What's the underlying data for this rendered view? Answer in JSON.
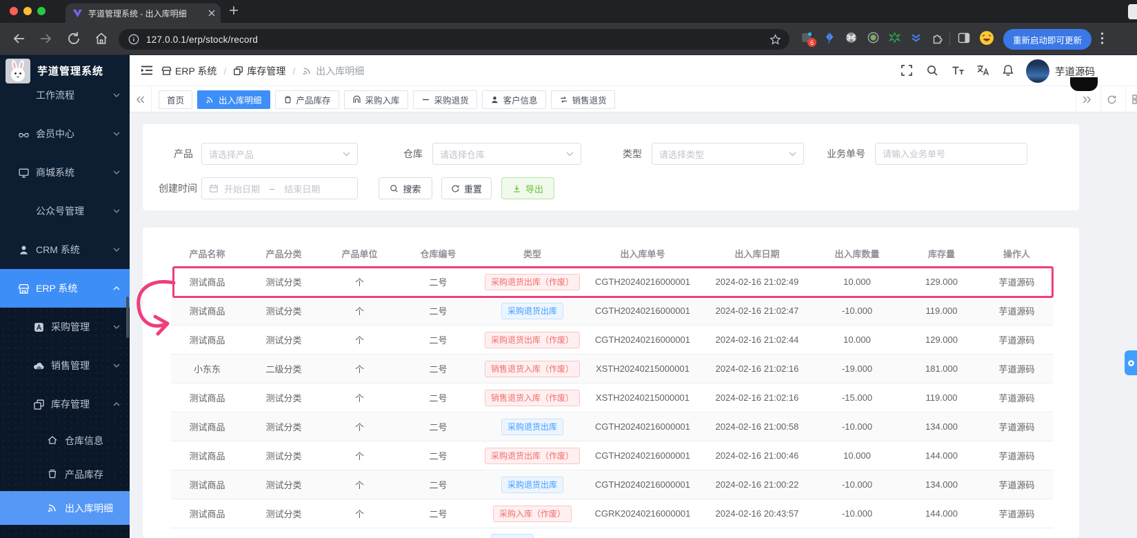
{
  "browser": {
    "tab_title": "芋道管理系统 - 出入库明细",
    "url": "127.0.0.1/erp/stock/record",
    "update_button": "重新启动即可更新",
    "ext_badge": "6"
  },
  "sidebar": {
    "app_title": "芋道管理系统",
    "items": [
      {
        "label": "工作流程"
      },
      {
        "label": "会员中心"
      },
      {
        "label": "商城系统"
      },
      {
        "label": "公众号管理"
      },
      {
        "label": "CRM 系统"
      },
      {
        "label": "ERP 系统"
      },
      {
        "label": "采购管理"
      },
      {
        "label": "销售管理"
      },
      {
        "label": "库存管理"
      },
      {
        "label": "仓库信息"
      },
      {
        "label": "产品库存"
      },
      {
        "label": "出入库明细"
      }
    ]
  },
  "header": {
    "separator": "/",
    "breadcrumb": [
      {
        "label": "ERP 系统"
      },
      {
        "label": "库存管理"
      },
      {
        "label": "出入库明细"
      }
    ],
    "user_name": "芋道源码"
  },
  "tabs": [
    {
      "label": "首页"
    },
    {
      "label": "出入库明细"
    },
    {
      "label": "产品库存"
    },
    {
      "label": "采购入库"
    },
    {
      "label": "采购退货"
    },
    {
      "label": "客户信息"
    },
    {
      "label": "销售退货"
    }
  ],
  "filters": {
    "product_label": "产品",
    "product_placeholder": "请选择产品",
    "warehouse_label": "仓库",
    "warehouse_placeholder": "请选择仓库",
    "type_label": "类型",
    "type_placeholder": "请选择类型",
    "bizno_label": "业务单号",
    "bizno_placeholder": "请输入业务单号",
    "created_label": "创建时间",
    "date_start_placeholder": "开始日期",
    "date_separator": "–",
    "date_end_placeholder": "结束日期",
    "search_label": "搜索",
    "reset_label": "重置",
    "export_label": "导出"
  },
  "table": {
    "columns": [
      "产品名称",
      "产品分类",
      "产品单位",
      "仓库编号",
      "类型",
      "出入库单号",
      "出入库日期",
      "出入库数量",
      "库存量",
      "操作人"
    ],
    "rows": [
      {
        "name": "测试商品",
        "category": "测试分类",
        "unit": "个",
        "warehouse": "二号",
        "type": "采购退货出库（作废）",
        "type_style": "danger",
        "order_no": "CGTH20240216000001",
        "date": "2024-02-16 21:02:49",
        "qty": "10.000",
        "stock": "129.000",
        "operator": "芋道源码"
      },
      {
        "name": "测试商品",
        "category": "测试分类",
        "unit": "个",
        "warehouse": "二号",
        "type": "采购退货出库",
        "type_style": "info",
        "order_no": "CGTH20240216000001",
        "date": "2024-02-16 21:02:47",
        "qty": "-10.000",
        "stock": "119.000",
        "operator": "芋道源码"
      },
      {
        "name": "测试商品",
        "category": "测试分类",
        "unit": "个",
        "warehouse": "二号",
        "type": "采购退货出库（作废）",
        "type_style": "danger",
        "order_no": "CGTH20240216000001",
        "date": "2024-02-16 21:02:44",
        "qty": "10.000",
        "stock": "129.000",
        "operator": "芋道源码"
      },
      {
        "name": "小东东",
        "category": "二级分类",
        "unit": "个",
        "warehouse": "二号",
        "type": "销售退货入库（作废）",
        "type_style": "danger",
        "order_no": "XSTH20240215000001",
        "date": "2024-02-16 21:02:16",
        "qty": "-19.000",
        "stock": "181.000",
        "operator": "芋道源码"
      },
      {
        "name": "测试商品",
        "category": "测试分类",
        "unit": "个",
        "warehouse": "二号",
        "type": "销售退货入库（作废）",
        "type_style": "danger",
        "order_no": "XSTH20240215000001",
        "date": "2024-02-16 21:02:16",
        "qty": "-15.000",
        "stock": "119.000",
        "operator": "芋道源码"
      },
      {
        "name": "测试商品",
        "category": "测试分类",
        "unit": "个",
        "warehouse": "二号",
        "type": "采购退货出库",
        "type_style": "info",
        "order_no": "CGTH20240216000001",
        "date": "2024-02-16 21:00:58",
        "qty": "-10.000",
        "stock": "134.000",
        "operator": "芋道源码"
      },
      {
        "name": "测试商品",
        "category": "测试分类",
        "unit": "个",
        "warehouse": "二号",
        "type": "采购退货出库（作废）",
        "type_style": "danger",
        "order_no": "CGTH20240216000001",
        "date": "2024-02-16 21:00:46",
        "qty": "10.000",
        "stock": "144.000",
        "operator": "芋道源码"
      },
      {
        "name": "测试商品",
        "category": "测试分类",
        "unit": "个",
        "warehouse": "二号",
        "type": "采购退货出库",
        "type_style": "info",
        "order_no": "CGTH20240216000001",
        "date": "2024-02-16 21:00:22",
        "qty": "-10.000",
        "stock": "134.000",
        "operator": "芋道源码"
      },
      {
        "name": "测试商品",
        "category": "测试分类",
        "unit": "个",
        "warehouse": "二号",
        "type": "采购入库（作废）",
        "type_style": "danger",
        "order_no": "CGRK20240216000001",
        "date": "2024-02-16 20:43:57",
        "qty": "-10.000",
        "stock": "144.000",
        "operator": "芋道源码"
      }
    ]
  },
  "colors": {
    "accent_blue": "#3e8ef7",
    "annotation_pink": "#ef3d7d",
    "tag_danger": "#f56c6c",
    "tag_info": "#409eff",
    "export_green": "#67c23a",
    "sidebar_bg": "#0d1d32"
  }
}
